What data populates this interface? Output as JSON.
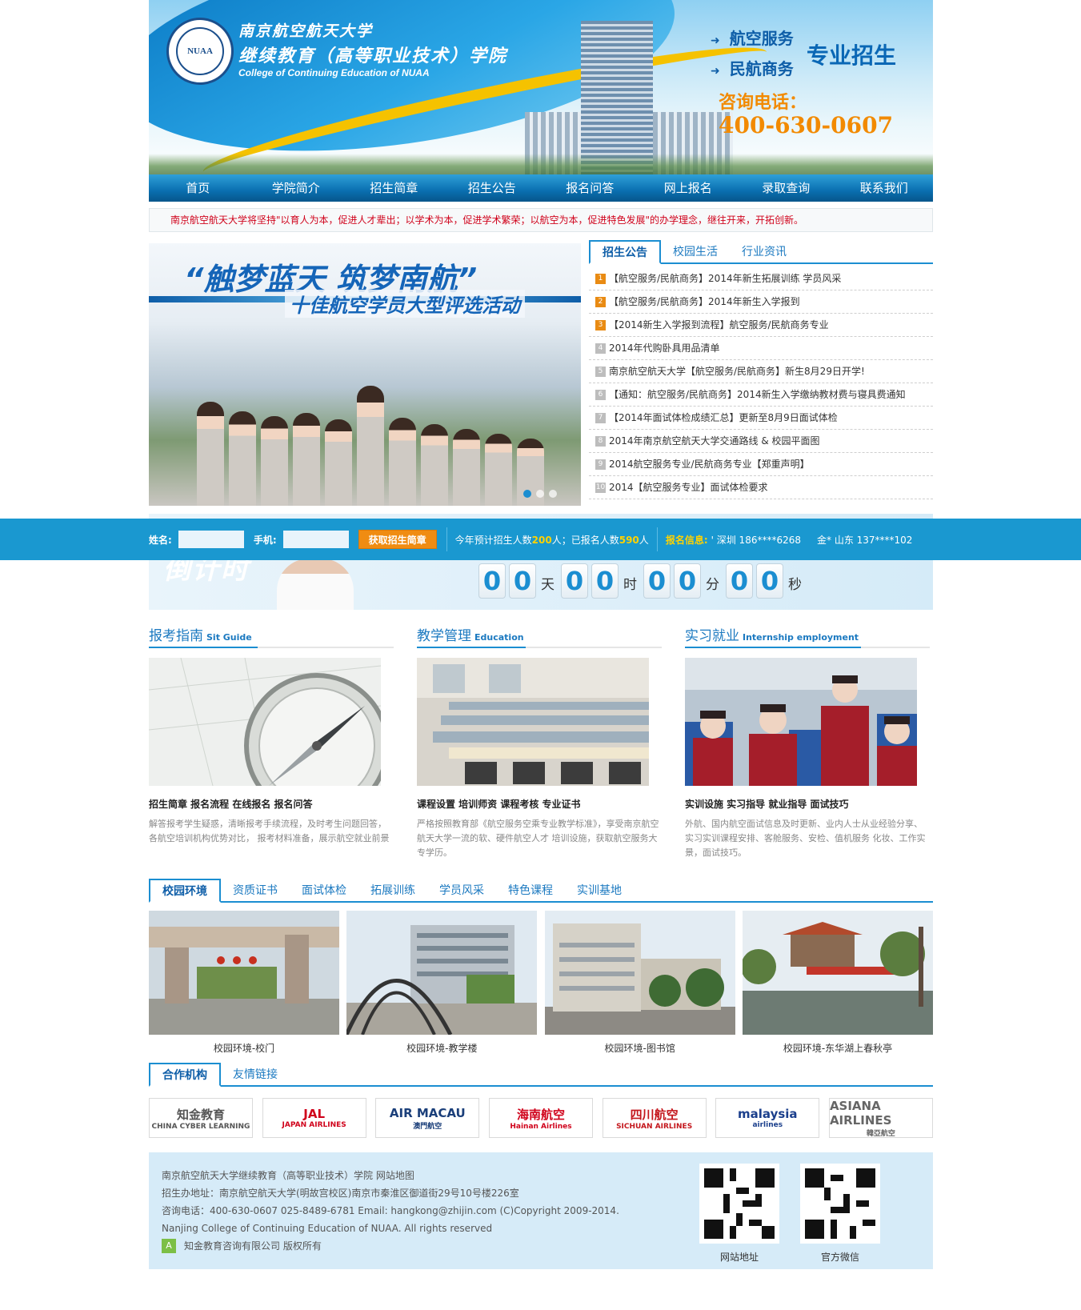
{
  "header": {
    "logo_text": "NUAA",
    "title_cn_1": "南京航空航天大学",
    "title_cn_2": "继续教育（高等职业技术）学院",
    "title_en": "College of Continuing Education of NUAA",
    "service_1": "航空服务",
    "service_2": "民航商务",
    "specialty": "专业招生",
    "hotline_label": "咨询电话：",
    "hotline": "400-630-0607"
  },
  "nav": [
    "首页",
    "学院简介",
    "招生简章",
    "招生公告",
    "报名问答",
    "网上报名",
    "录取查询",
    "联系我们"
  ],
  "notice": "南京航空航天大学将坚持\"以育人为本，促进人才辈出；以学术为本，促进学术繁荣；以航空为本，促进特色发展\"的办学理念，继往开来，开拓创新。",
  "slider": {
    "headline": "“触梦蓝天  筑梦南航”",
    "subline": "十佳航空学员大型评选活动"
  },
  "news": {
    "tabs": [
      "招生公告",
      "校园生活",
      "行业资讯"
    ],
    "items": [
      {
        "n": "1",
        "t": "【航空服务/民航商务】2014年新生拓展训练 学员风采"
      },
      {
        "n": "2",
        "t": "【航空服务/民航商务】2014年新生入学报到"
      },
      {
        "n": "3",
        "t": "【2014新生入学报到流程】航空服务/民航商务专业"
      },
      {
        "n": "4",
        "t": "2014年代购卧具用品清单"
      },
      {
        "n": "5",
        "t": "南京航空航天大学【航空服务/民航商务】新生8月29日开学!"
      },
      {
        "n": "6",
        "t": "【通知：航空服务/民航商务】2014新生入学缴纳教材费与寝具费通知"
      },
      {
        "n": "7",
        "t": "【2014年面试体检成绩汇总】更新至8月9日面试体检"
      },
      {
        "n": "8",
        "t": "2014年南京航空航天大学交通路线 & 校园平面图"
      },
      {
        "n": "9",
        "t": "2014航空服务专业/民航商务专业【郑重声明】"
      },
      {
        "n": "10",
        "t": "2014【航空服务专业】面试体检要求"
      }
    ]
  },
  "countdown": {
    "title": "倒计时",
    "days": [
      "0",
      "0"
    ],
    "days_unit": "天",
    "hours": [
      "0",
      "0"
    ],
    "hours_unit": "时",
    "minutes": [
      "0",
      "0"
    ],
    "minutes_unit": "分",
    "seconds": [
      "0",
      "0"
    ],
    "seconds_unit": "秒"
  },
  "floatbar": {
    "name_label": "姓名:",
    "phone_label": "手机:",
    "button": "获取招生简章",
    "plan_prefix": "今年预计招生人数",
    "plan_count": "200",
    "plan_mid": "人；已报名人数",
    "signed_count": "590",
    "plan_suffix": "人",
    "info_label": "报名信息:",
    "info_1": "' 深圳 186****6268",
    "info_2": "金* 山东 137****102"
  },
  "columns": [
    {
      "cn": "报考指南",
      "en": "Sit Guide",
      "sub": "招生简章 报名流程 在线报名 报名问答",
      "desc": "解答报考学生疑惑，清晰报考手续流程，及时考生问题回答，各航空培训机构优势对比， 报考材料准备，展示航空就业前景"
    },
    {
      "cn": "教学管理",
      "en": "Education",
      "sub": "课程设置 培训师资 课程考核 专业证书",
      "desc": "严格按照教育部《航空服务空乘专业教学标准》，享受南京航空航天大学一流的软、硬件航空人才 培训设施，获取航空服务大专学历。"
    },
    {
      "cn": "实习就业",
      "en": "Internship employment",
      "sub": "实训设施 实习指导 就业指导 面试技巧",
      "desc": "外航、国内航空面试信息及时更新、业内人士从业经验分享、实习实训课程安排、客舱服务、安检、值机服务 化妆、工作实景，面试技巧。"
    }
  ],
  "campus": {
    "tabs": [
      "校园环境",
      "资质证书",
      "面试体检",
      "拓展训练",
      "学员风采",
      "特色课程",
      "实训基地"
    ],
    "photos": [
      "校园环境-校门",
      "校园环境-教学楼",
      "校园环境-图书馆",
      "校园环境-东华湖上春秋亭"
    ]
  },
  "partners": {
    "tabs": [
      "合作机构",
      "友情链接"
    ],
    "logos": [
      {
        "name": "知金教育",
        "sub": "CHINA CYBER LEARNING",
        "color": "#555555"
      },
      {
        "name": "JAL",
        "sub": "JAPAN AIRLINES",
        "color": "#d0021b"
      },
      {
        "name": "AIR MACAU",
        "sub": "澳門航空",
        "color": "#1b3f7a"
      },
      {
        "name": "海南航空",
        "sub": "Hainan Airlines",
        "color": "#d0021b"
      },
      {
        "name": "四川航空",
        "sub": "SICHUAN AIRLINES",
        "color": "#c4161c"
      },
      {
        "name": "malaysia",
        "sub": "airlines",
        "color": "#1b3f8c"
      },
      {
        "name": "ASIANA AIRLINES",
        "sub": "韓亞航空",
        "color": "#666666"
      }
    ]
  },
  "footer": {
    "line1": "南京航空航天大学继续教育（高等职业技术）学院 网站地图",
    "line2": "招生办地址：南京航空航天大学(明故宫校区)南京市秦淮区御道街29号10号楼226室",
    "line3": "咨询电话：400-630-0607 025-8489-6781 Email: hangkong@zhijin.com (C)Copyright 2009-2014.",
    "line4": "Nanjing College of Continuing Education of NUAA. All rights reserved",
    "line5": "知金教育咨询有限公司 版权所有",
    "copyright_icon": "A",
    "qr_1": "网站地址",
    "qr_2": "官方微信"
  },
  "colors": {
    "accent": "#1b8ed1",
    "nav": "#0a6fb0",
    "orange": "#f08c12",
    "notice": "#d0021b"
  }
}
